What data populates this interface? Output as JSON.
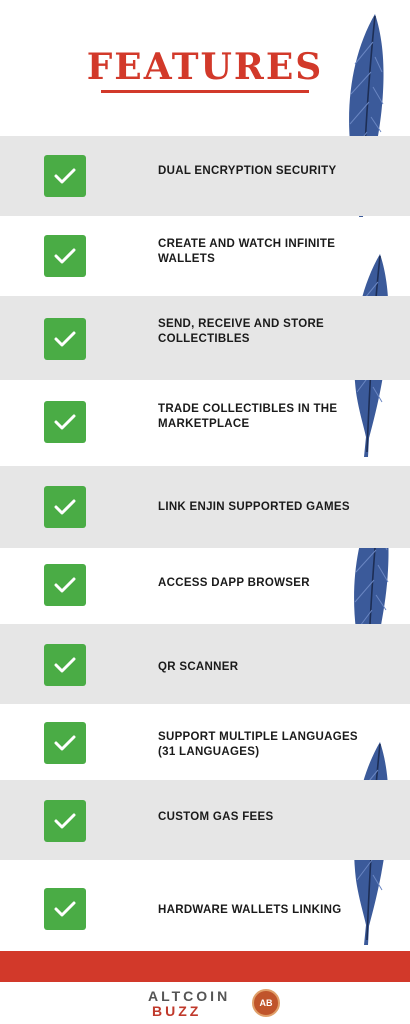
{
  "header": {
    "title": "FEATURES"
  },
  "features": [
    {
      "label": "DUAL ENCRYPTION SECURITY"
    },
    {
      "label": "CREATE AND WATCH INFINITE WALLETS"
    },
    {
      "label": "SEND, RECEIVE AND STORE COLLECTIBLES"
    },
    {
      "label": "TRADE COLLECTIBLES IN THE MARKETPLACE"
    },
    {
      "label": "LINK ENJIN SUPPORTED GAMES"
    },
    {
      "label": "ACCESS DAPP BROWSER"
    },
    {
      "label": "QR SCANNER"
    },
    {
      "label": "SUPPORT MULTIPLE LANGUAGES (31 LANGUAGES)"
    },
    {
      "label": "CUSTOM GAS FEES"
    },
    {
      "label": "HARDWARE WALLETS LINKING"
    }
  ],
  "footer": {
    "logo_word_1": "ALTCOIN",
    "logo_word_2": "BUZZ",
    "logo_badge": "AB"
  },
  "colors": {
    "accent": "#d2392a",
    "check": "#4aac45",
    "feather": "#3b5a9a",
    "row_shade": "#e6e6e6"
  },
  "icons": [
    "check-icon",
    "feather-icon"
  ]
}
